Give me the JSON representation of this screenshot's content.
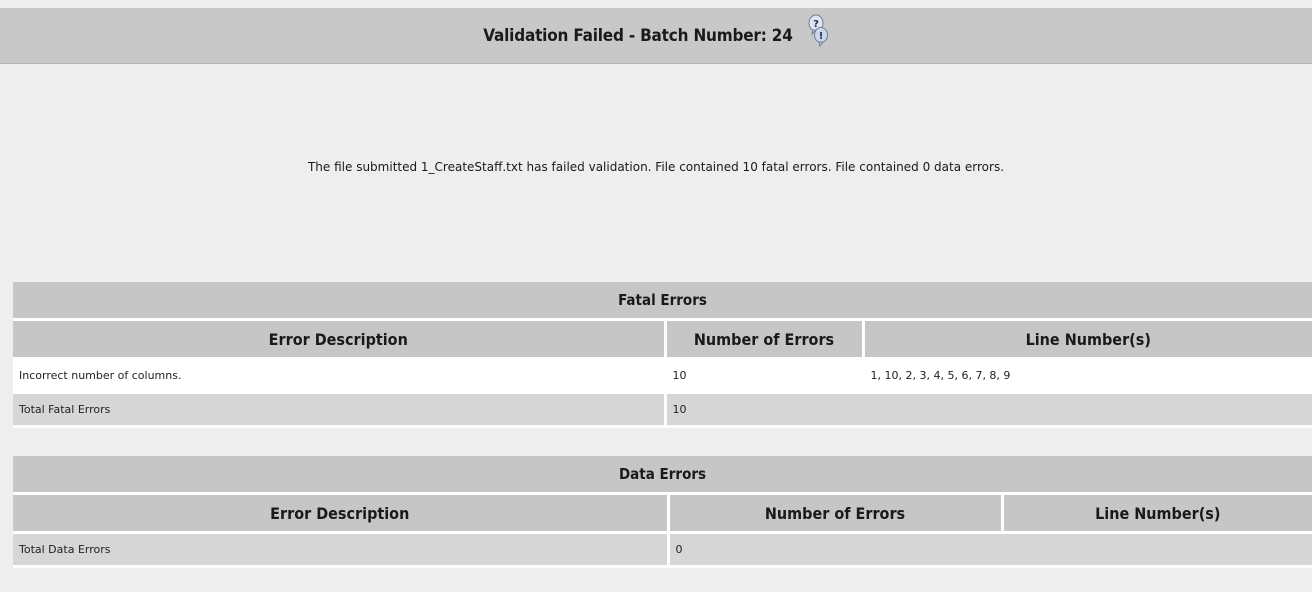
{
  "title_bar": {
    "title": "Validation Failed - Batch Number: 24",
    "help_icon": "help-question-bubble-icon"
  },
  "summary": "The file submitted 1_CreateStaff.txt has failed validation. File contained 10 fatal errors. File contained 0 data errors.",
  "fatal_errors": {
    "title": "Fatal Errors",
    "headers": [
      "Error Description",
      "Number of Errors",
      "Line Number(s)"
    ],
    "rows": [
      {
        "description": "Incorrect number of columns.",
        "count": "10",
        "lines": "1, 10, 2, 3, 4, 5, 6, 7, 8, 9"
      }
    ],
    "total_label": "Total Fatal Errors",
    "total_value": "10"
  },
  "data_errors": {
    "title": "Data Errors",
    "headers": [
      "Error Description",
      "Number of Errors",
      "Line Number(s)"
    ],
    "total_label": "Total Data Errors",
    "total_value": "0"
  },
  "colors": {
    "header_grey": "#c6c6c6",
    "row_grey": "#d6d6d6",
    "page_bg": "#eeeeee",
    "heading_blue": "#1b5fa8"
  }
}
